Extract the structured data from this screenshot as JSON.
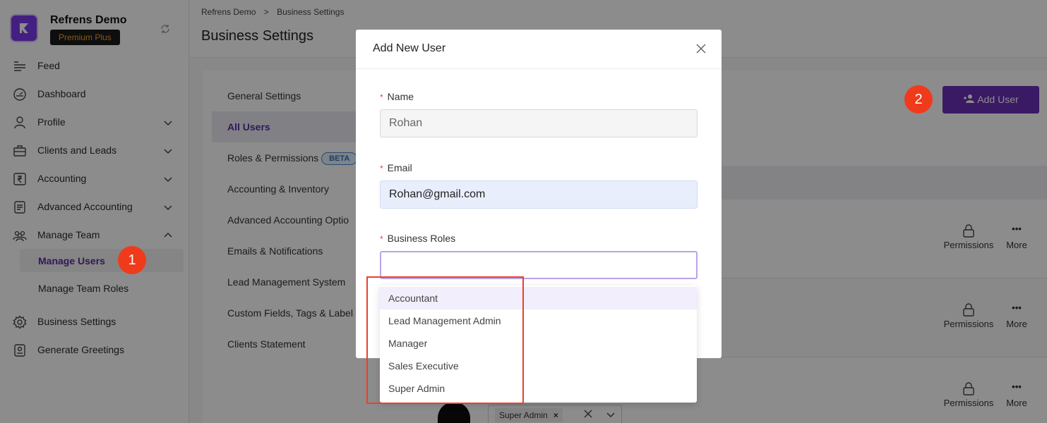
{
  "org": {
    "name": "Refrens Demo",
    "plan": "Premium Plus"
  },
  "sidebar": {
    "items": [
      {
        "label": "Feed",
        "icon": "feed-icon"
      },
      {
        "label": "Dashboard",
        "icon": "dashboard-icon"
      },
      {
        "label": "Profile",
        "icon": "user-icon"
      },
      {
        "label": "Clients and Leads",
        "icon": "briefcase-icon"
      },
      {
        "label": "Accounting",
        "icon": "rupee-icon"
      },
      {
        "label": "Advanced Accounting",
        "icon": "document-icon"
      },
      {
        "label": "Manage Team",
        "icon": "team-icon"
      },
      {
        "label": "Business Settings",
        "icon": "gear-icon"
      },
      {
        "label": "Generate Greetings",
        "icon": "greeting-icon"
      }
    ],
    "sub_items": [
      {
        "label": "Manage Users"
      },
      {
        "label": "Manage Team Roles"
      }
    ]
  },
  "markers": {
    "one": "1",
    "two": "2"
  },
  "breadcrumb": {
    "root": "Refrens Demo",
    "sep": ">",
    "current": "Business Settings"
  },
  "page": {
    "title": "Business Settings"
  },
  "settings_menu": [
    "General Settings",
    "All Users",
    "Roles & Permissions",
    "Accounting & Inventory",
    "Advanced Accounting Optio",
    "Emails & Notifications",
    "Lead Management System",
    "Custom Fields, Tags & Label",
    "Clients Statement"
  ],
  "beta_label": "BETA",
  "add_user_button": "Add User",
  "row_actions": {
    "permissions": "Permissions",
    "more": "More"
  },
  "row_chip": "Super Admin",
  "modal": {
    "title": "Add New User",
    "name_label": "Name",
    "name_value": "Rohan",
    "email_label": "Email",
    "email_value": "Rohan@gmail.com",
    "roles_label": "Business Roles",
    "roles_value": "",
    "role_options": [
      "Accountant",
      "Lead Management Admin",
      "Manager",
      "Sales Executive",
      "Super Admin"
    ]
  },
  "colors": {
    "accent": "#6b2fb8",
    "marker": "#ef3b1b",
    "highlight_box": "#e8422a"
  }
}
